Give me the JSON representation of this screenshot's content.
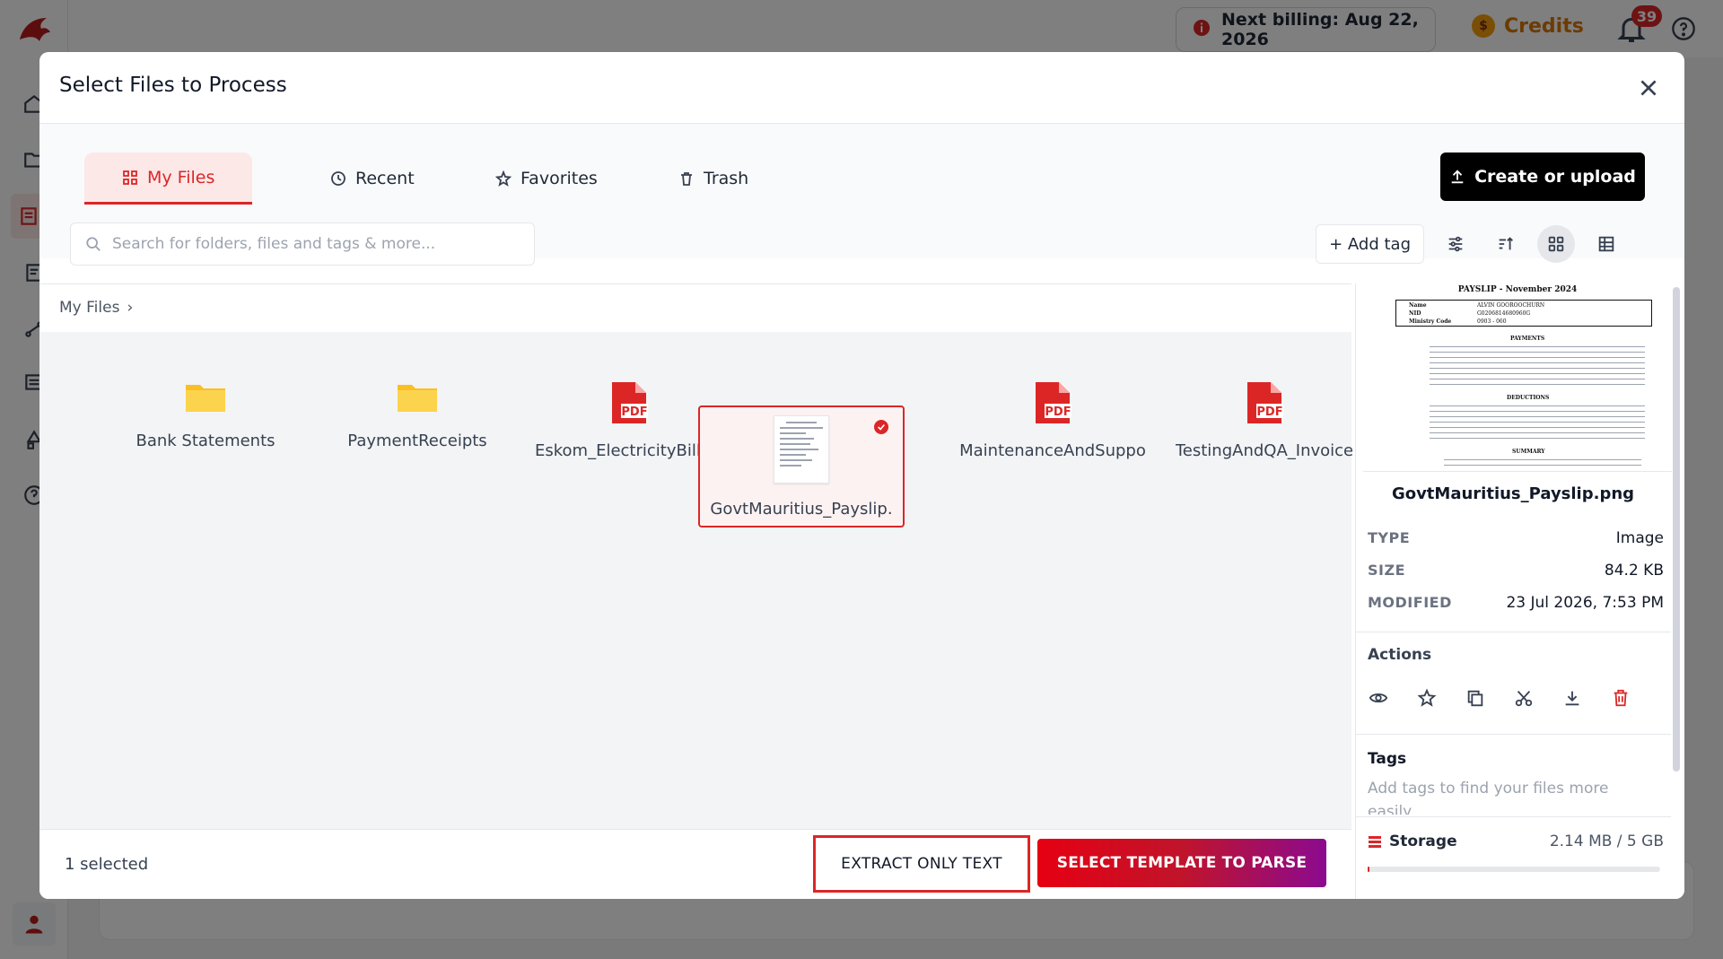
{
  "topbar": {
    "billing_text": "Next billing: Aug 22, 2026",
    "credits_label": "Credits",
    "notifications_count": "39"
  },
  "modal": {
    "title": "Select Files to Process",
    "tabs": [
      {
        "label": "My Files",
        "active": true
      },
      {
        "label": "Recent"
      },
      {
        "label": "Favorites"
      },
      {
        "label": "Trash"
      }
    ],
    "create_button": "Create or upload",
    "search_placeholder": "Search for folders, files and tags & more...",
    "add_tag_label": "+ Add tag",
    "breadcrumb": "My Files",
    "files": [
      {
        "name": "Bank Statements",
        "kind": "folder"
      },
      {
        "name": "PaymentReceipts",
        "kind": "folder"
      },
      {
        "name": "Eskom_ElectricityBill.pc",
        "kind": "pdf"
      },
      {
        "name": "GovtMauritius_Payslip.",
        "kind": "image",
        "selected": true
      },
      {
        "name": "MaintenanceAndSuppo",
        "kind": "pdf"
      },
      {
        "name": "TestingAndQA_Invoice",
        "kind": "pdf"
      }
    ],
    "footer": {
      "selected_count": "1 selected",
      "extract_button": "EXTRACT ONLY TEXT",
      "parse_button": "SELECT TEMPLATE TO PARSE"
    },
    "details": {
      "preview_title": "PAYSLIP - November 2024",
      "preview_rows": [
        {
          "label": "Name",
          "value": "ALVIN GOOROOCHURN"
        },
        {
          "label": "NID",
          "value": "G0206814680960G"
        },
        {
          "label": "Ministry Code",
          "value": "0903 - 060"
        }
      ],
      "preview_sections": [
        "PAYMENTS",
        "DEDUCTIONS",
        "SUMMARY"
      ],
      "filename": "GovtMauritius_Payslip.png",
      "type_label": "TYPE",
      "type_value": "Image",
      "size_label": "SIZE",
      "size_value": "84.2 KB",
      "modified_label": "MODIFIED",
      "modified_value": "23 Jul 2026, 7:53 PM",
      "actions_title": "Actions",
      "tags_title": "Tags",
      "tags_hint": "Add tags to find your files more easily",
      "storage_label": "Storage",
      "storage_value": "2.14 MB / 5 GB",
      "storage_fraction": 0.0004
    }
  },
  "colors": {
    "accent": "#dc2626",
    "primary_dark": "#000000",
    "gradient_start": "#e60012",
    "gradient_end": "#8b0a8f"
  }
}
